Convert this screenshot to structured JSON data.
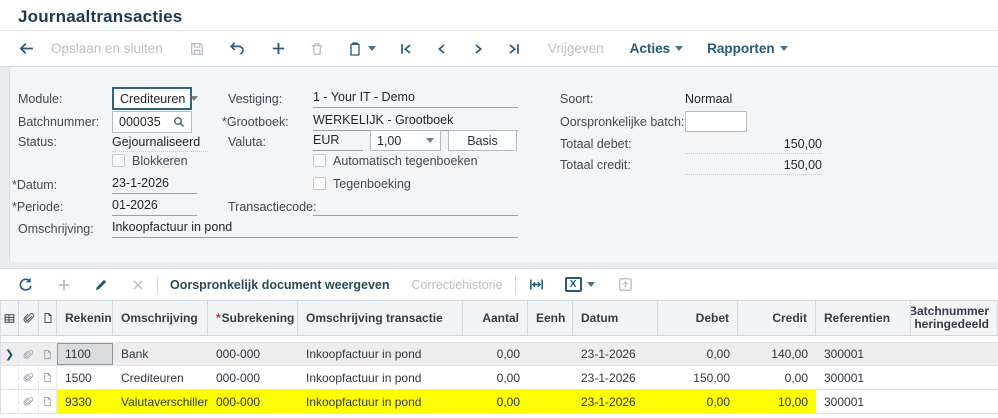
{
  "page": {
    "title": "Journaaltransacties"
  },
  "colors": {
    "accent": "#27597a",
    "highlight": "#ffff00",
    "selected_row": "#ededee",
    "panel": "#f3f5f6"
  },
  "toolbar": {
    "opslaan_en_sluiten": "Opslaan en sluiten",
    "vrijgeven": "Vrijgeven",
    "acties": "Acties",
    "rapporten": "Rapporten",
    "icons": [
      "back-arrow-icon",
      "save-icon",
      "undo-icon",
      "add-icon",
      "delete-icon",
      "clipboard-icon",
      "go-first-icon",
      "go-previous-icon",
      "go-next-icon",
      "go-last-icon"
    ]
  },
  "form": {
    "required_marker": "*",
    "module": {
      "label": "Module:",
      "value": "Crediteuren"
    },
    "batchnummer": {
      "label": "Batchnummer:",
      "value": "000035"
    },
    "status": {
      "label": "Status:",
      "value": "Gejournaliseerd"
    },
    "blokkeren": {
      "label": "Blokkeren"
    },
    "datum": {
      "label": "Datum:",
      "value": "23-1-2026"
    },
    "periode": {
      "label": "Periode:",
      "value": "01-2026"
    },
    "omschrijving": {
      "label": "Omschrijving:",
      "value": "Inkoopfactuur in pond"
    },
    "vestiging": {
      "label": "Vestiging:",
      "value": "1 - Your IT - Demo"
    },
    "grootboek": {
      "label": "Grootboek:",
      "value": "WERKELIJK - Grootboek"
    },
    "valuta": {
      "label": "Valuta:",
      "value": "EUR",
      "koers": "1,00",
      "basis_button": "Basis"
    },
    "automatisch_tegenboeken": {
      "label": "Automatisch tegenboeken"
    },
    "tegenboeking": {
      "label": "Tegenboeking"
    },
    "transactiecode": {
      "label": "Transactiecode:",
      "value": ""
    },
    "soort": {
      "label": "Soort:",
      "value": "Normaal"
    },
    "oorspronkelijke_batch": {
      "label": "Oorspronkelijke batch:",
      "value": ""
    },
    "totaal_debet": {
      "label": "Totaal debet:",
      "value": "150,00"
    },
    "totaal_credit": {
      "label": "Totaal credit:",
      "value": "150,00"
    }
  },
  "grid_toolbar": {
    "oorspronkelijk_document": "Oorspronkelijk document weergeven",
    "correctiehistorie": "Correctiehistorie",
    "icons": [
      "refresh-icon",
      "add-row-icon",
      "edit-icon",
      "delete-row-icon",
      "fit-width-icon",
      "export-excel-icon",
      "upload-icon"
    ]
  },
  "table": {
    "columns": {
      "rekening": "Rekenin",
      "omschrijving": "Omschrijving",
      "subrekening_required": "*",
      "subrekening": "Subrekening",
      "omschrijving_transactie": "Omschrijving transactie",
      "aantal": "Aantal",
      "eenheid": "Eenh",
      "datum": "Datum",
      "debet": "Debet",
      "credit": "Credit",
      "referentien": "Referentien",
      "batchnummer_heringedeeld": "Batchnummer heringedeeld"
    },
    "rows": [
      {
        "rekening": "1100",
        "omschrijving": "Bank",
        "subrekening": "000-000",
        "omschrijving_transactie": "Inkoopfactuur in pond",
        "aantal": "0,00",
        "eenheid": "",
        "datum": "23-1-2026",
        "debet": "0,00",
        "credit": "140,00",
        "referentien": "300001",
        "batchnummer_heringedeeld": ""
      },
      {
        "rekening": "1500",
        "omschrijving": "Crediteuren",
        "subrekening": "000-000",
        "omschrijving_transactie": "Inkoopfactuur in pond",
        "aantal": "0,00",
        "eenheid": "",
        "datum": "23-1-2026",
        "debet": "150,00",
        "credit": "0,00",
        "referentien": "300001",
        "batchnummer_heringedeeld": ""
      },
      {
        "rekening": "9330",
        "omschrijving": "Valutaverschillen",
        "subrekening": "000-000",
        "omschrijving_transactie": "Inkoopfactuur in pond",
        "aantal": "0,00",
        "eenheid": "",
        "datum": "23-1-2026",
        "debet": "0,00",
        "credit": "10,00",
        "referentien": "300001",
        "batchnummer_heringedeeld": ""
      }
    ]
  }
}
